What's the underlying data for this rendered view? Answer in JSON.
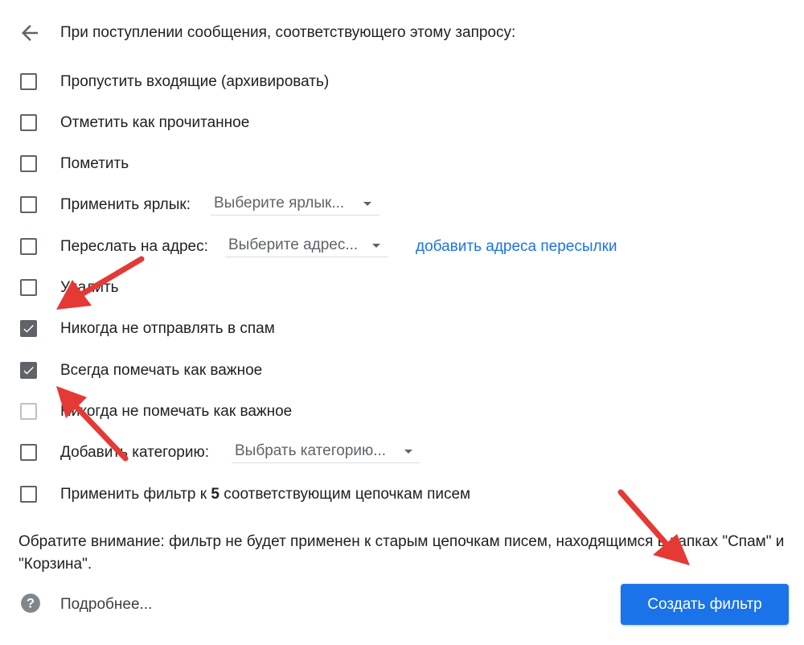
{
  "header": {
    "text": "При поступлении сообщения, соответствующего этому запросу:"
  },
  "options": [
    {
      "label": "Пропустить входящие (архивировать)",
      "checked": false,
      "disabled": false
    },
    {
      "label": "Отметить как прочитанное",
      "checked": false,
      "disabled": false
    },
    {
      "label": "Пометить",
      "checked": false,
      "disabled": false
    },
    {
      "label": "Применить ярлык:",
      "checked": false,
      "disabled": false,
      "dropdown": "Выберите ярлык..."
    },
    {
      "label": "Переслать на адрес:",
      "checked": false,
      "disabled": false,
      "dropdown": "Выберите адрес...",
      "link": "добавить адреса пересылки"
    },
    {
      "label": "Удалить",
      "checked": false,
      "disabled": false
    },
    {
      "label": "Никогда не отправлять в спам",
      "checked": true,
      "disabled": false
    },
    {
      "label": "Всегда помечать как важное",
      "checked": true,
      "disabled": false
    },
    {
      "label": "Никогда не помечать как важное",
      "checked": false,
      "disabled": true
    },
    {
      "label": "Добавить категорию:",
      "checked": false,
      "disabled": false,
      "dropdown": "Выбрать категорию..."
    },
    {
      "label_before": "Применить фильтр к ",
      "label_count": "5",
      "label_after": " соответствующим цепочкам писем",
      "checked": false,
      "disabled": false
    }
  ],
  "note": "Обратите внимание: фильтр не будет применен к старым цепочкам писем, находящимся в папках \"Спам\" и \"Корзина\".",
  "footer": {
    "help_label": "Подробнее...",
    "create_button": "Создать фильтр"
  },
  "colors": {
    "accent": "#1a73e8",
    "checkbox": "#5f6368",
    "annotation_arrow": "#e53935"
  }
}
